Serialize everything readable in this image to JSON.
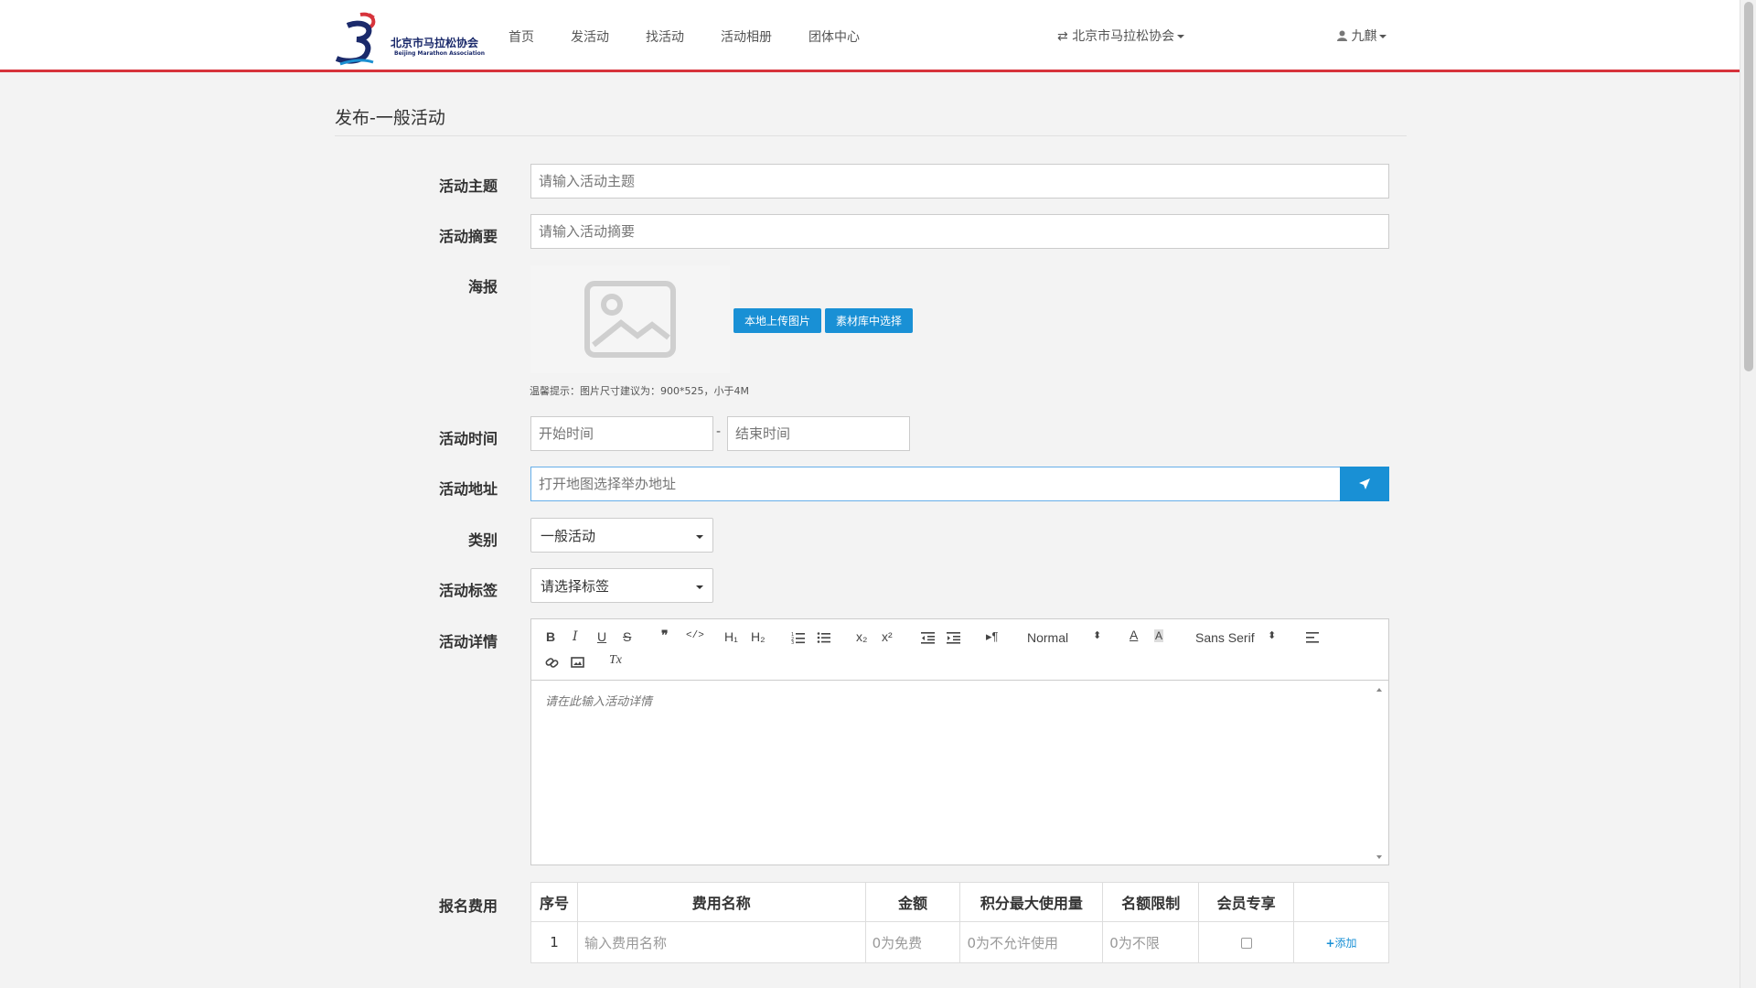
{
  "header": {
    "logo_cn": "北京市马拉松协会",
    "logo_en": "Beijing Marathon Association",
    "nav": [
      "首页",
      "发活动",
      "找活动",
      "活动相册",
      "团体中心"
    ],
    "org_switch": "北京市马拉松协会",
    "user": "九麒"
  },
  "page_title": "发布-一般活动",
  "form": {
    "topic": {
      "label": "活动主题",
      "placeholder": "请输入活动主题"
    },
    "summary": {
      "label": "活动摘要",
      "placeholder": "请输入活动摘要"
    },
    "poster": {
      "label": "海报",
      "upload_local": "本地上传图片",
      "from_library": "素材库中选择",
      "hint": "温馨提示：图片尺寸建议为：900*525，小于4M"
    },
    "time": {
      "label": "活动时间",
      "start_placeholder": "开始时间",
      "separator": "-",
      "end_placeholder": "结束时间"
    },
    "address": {
      "label": "活动地址",
      "placeholder": "打开地图选择举办地址"
    },
    "category": {
      "label": "类别",
      "value": "一般活动"
    },
    "tags": {
      "label": "活动标签",
      "value": "请选择标签"
    },
    "details": {
      "label": "活动详情",
      "placeholder": "请在此输入活动详情",
      "toolbar": {
        "bold": "B",
        "italic": "I",
        "underline": "U",
        "strike": "S",
        "quote": "❞",
        "code": "</>",
        "h1": "H₁",
        "h2": "H₂",
        "sub": "x₂",
        "sup": "x²",
        "size": "Normal",
        "font": "Sans Serif",
        "clear": "Tx"
      }
    },
    "fee": {
      "label": "报名费用",
      "headers": [
        "序号",
        "费用名称",
        "金额",
        "积分最大使用量",
        "名额限制",
        "会员专享",
        ""
      ],
      "row": {
        "index": "1",
        "name_placeholder": "输入费用名称",
        "amount_placeholder": "0为免费",
        "points_placeholder": "0为不允许使用",
        "quota_placeholder": "0为不限",
        "add": "添加"
      }
    }
  },
  "colors": {
    "brand_red": "#d7333b",
    "primary_blue": "#1990d5"
  }
}
